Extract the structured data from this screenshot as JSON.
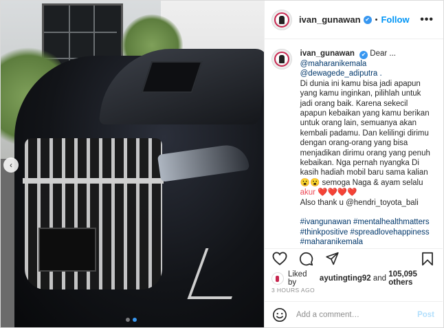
{
  "post": {
    "username": "ivan_gunawan",
    "separator": "•",
    "follow_label": "Follow",
    "more_label": "•••"
  },
  "caption": {
    "username": "ivan_gunawan",
    "lines": [
      "Dear ...",
      "@maharanikemala",
      "@dewagede_adiputra .",
      "Di dunia ini kamu bisa jadi apapun",
      "yang kamu inginkan, pilihlah untuk",
      "jadi orang baik. Karena sekecil",
      "apapun kebaikan yang kamu berikan",
      "untuk orang lain, semuanya akan",
      "kembali padamu. Dan kelilingi dirimu",
      "dengan orang-orang yang bisa",
      "menjadikan dirimu orang yang penuh",
      "kebaikan. Nga pernah nyangka Di",
      "kasih hadiah mobil baru sama kalian",
      "😮😮 semoga Naga & ayam selalu",
      "akur ❤️❤️❤️❤️",
      "Also thank u @hendri_toyota_bali",
      "",
      "#ivangunawan #mentalhealthmatters",
      "#thinkpositive #spreadlovehappiness",
      "#maharanikemala"
    ]
  },
  "likes": {
    "prefix": "Liked by",
    "user": "ayutingting92",
    "middle": "and",
    "count": "105,095 others"
  },
  "time_ago": "3 HOURS AGO",
  "comment": {
    "placeholder": "Add a comment…",
    "post_label": "Post"
  },
  "carousel": {
    "slide_count": 2,
    "active_index": 1
  },
  "colors": {
    "accent": "#0095f6",
    "verified": "#3897f0",
    "heart": "#ed4956"
  }
}
